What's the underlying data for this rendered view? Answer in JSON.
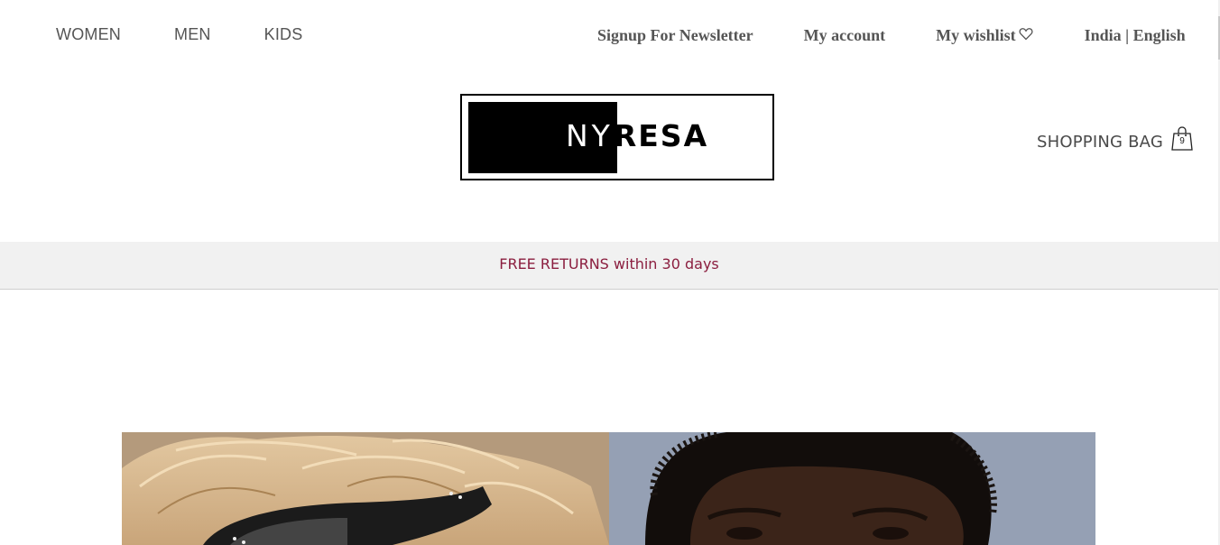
{
  "nav": {
    "women": "WOMEN",
    "men": "MEN",
    "kids": "KIDS"
  },
  "utility": {
    "newsletter": "Signup For Newsletter",
    "account": "My account",
    "wishlist": "My wishlist",
    "locale": "India | English"
  },
  "logo": {
    "part1": "NY",
    "part2": "RESA"
  },
  "bag": {
    "label": "SHOPPING BAG",
    "count": "9"
  },
  "promo": {
    "text": "FREE RETURNS within 30 days"
  },
  "hero": {
    "left_image": "woman-sunglasses-photo",
    "right_image": "man-portrait-photo"
  },
  "colors": {
    "promo_text": "#8b1e3f",
    "promo_bg": "#f1f1f1",
    "nav_text": "#555555"
  }
}
